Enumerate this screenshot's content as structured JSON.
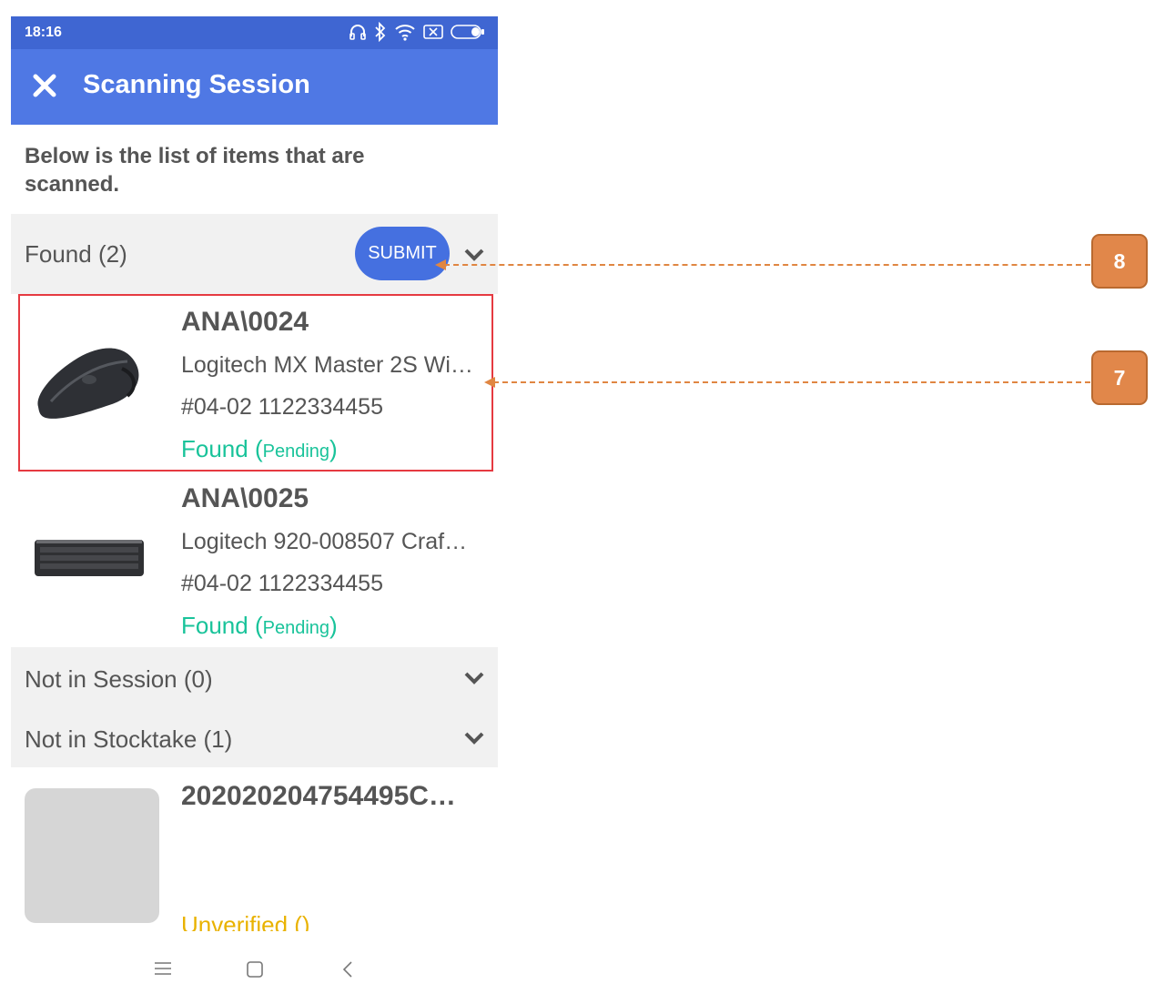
{
  "status_bar": {
    "time": "18:16"
  },
  "app_bar": {
    "title": "Scanning Session",
    "close_icon": "close-icon"
  },
  "intro_text": "Below is the list of items that are scanned.",
  "sections": {
    "found": {
      "label": "Found (2)",
      "submit_label": "SUBMIT"
    },
    "not_in_session": {
      "label": "Not in Session (0)"
    },
    "not_in_stocktake": {
      "label": "Not in Stocktake (1)"
    }
  },
  "found_items": [
    {
      "code": "ANA\\0024",
      "description": "Logitech MX Master 2S Wi…",
      "location": "#04-02 1122334455",
      "status": "Found",
      "status_detail": "Pending",
      "thumbnail": "mouse-image"
    },
    {
      "code": "ANA\\0025",
      "description": "Logitech 920-008507 Craf…",
      "location": "#04-02 1122334455",
      "status": "Found",
      "status_detail": "Pending",
      "thumbnail": "keyboard-image"
    }
  ],
  "stocktake_items": [
    {
      "code": "20202020475449​5C…",
      "status": "Unverified ()"
    }
  ],
  "callouts": {
    "first": "8",
    "second": "7"
  },
  "colors": {
    "app_bar": "#4f78e4",
    "status_bar": "#3f66d2",
    "found_green": "#19c39a",
    "unverified_yellow": "#e9b200",
    "highlight_red": "#e53a41",
    "callout_orange": "#e1874a"
  }
}
